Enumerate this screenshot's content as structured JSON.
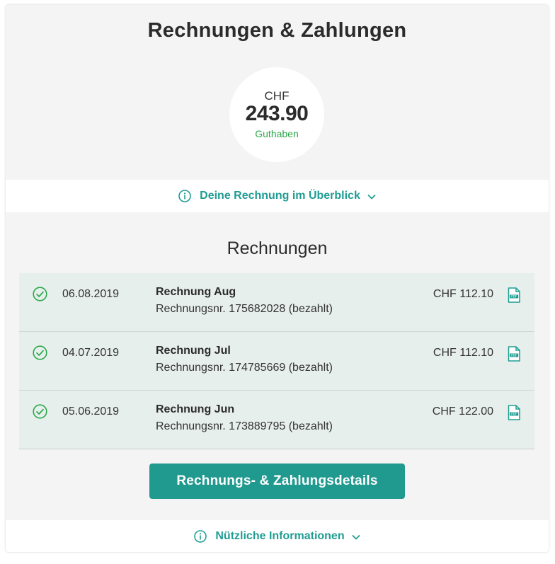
{
  "page": {
    "title": "Rechnungen & Zahlungen"
  },
  "balance": {
    "currency": "CHF",
    "amount": "243.90",
    "label": "Guthaben"
  },
  "overview_toggle": {
    "label": "Deine Rechnung im Überblick",
    "icon": "info-icon"
  },
  "invoices": {
    "title": "Rechnungen",
    "items": [
      {
        "date": "06.08.2019",
        "title": "Rechnung Aug",
        "subtitle": "Rechnungsnr. 175682028 (bezahlt)",
        "amount": "CHF 112.10",
        "status": "bezahlt"
      },
      {
        "date": "04.07.2019",
        "title": "Rechnung Jul",
        "subtitle": "Rechnungsnr. 174785669 (bezahlt)",
        "amount": "CHF 112.10",
        "status": "bezahlt"
      },
      {
        "date": "05.06.2019",
        "title": "Rechnung Jun",
        "subtitle": "Rechnungsnr. 173889795 (bezahlt)",
        "amount": "CHF 122.00",
        "status": "bezahlt"
      }
    ]
  },
  "details_button": {
    "label": "Rechnungs- & Zahlungsdetails"
  },
  "info_toggle": {
    "label": "Nützliche Informationen",
    "icon": "info-icon"
  },
  "colors": {
    "accent": "#20998f",
    "success": "#2aa84a",
    "row_background": "#e7efec",
    "card_background": "#f4f4f4"
  }
}
